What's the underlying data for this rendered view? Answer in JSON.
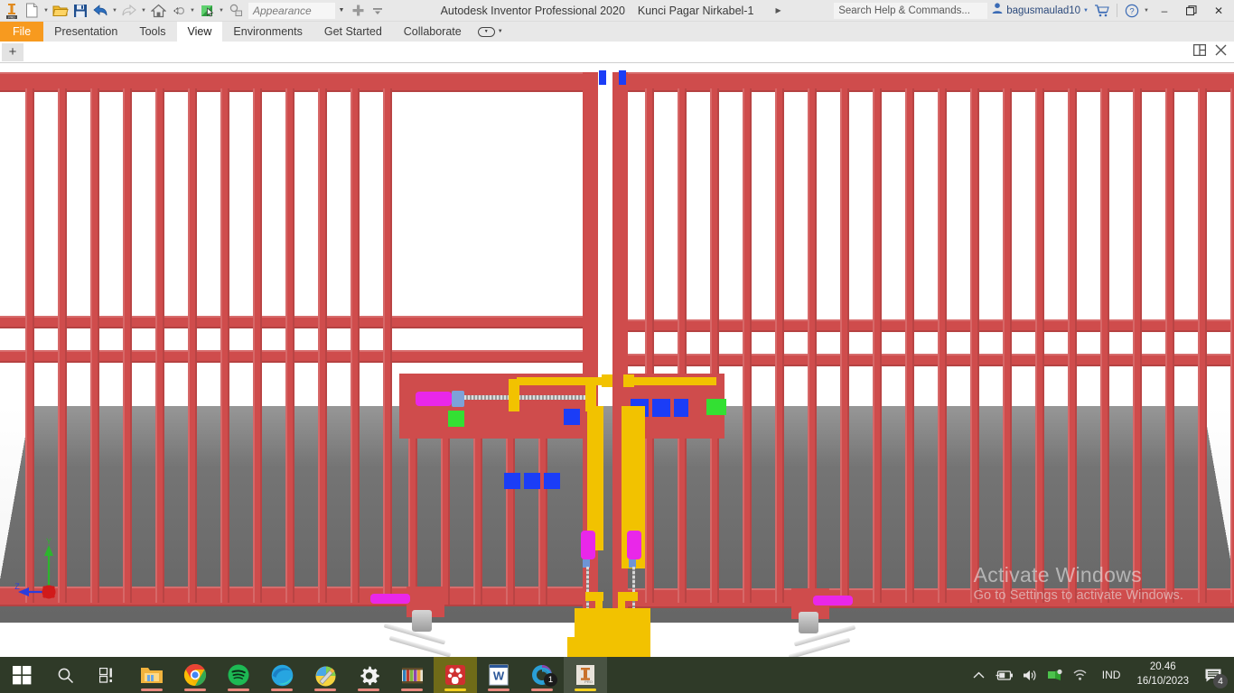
{
  "titlebar": {
    "app_logo": "inventor-pro-logo",
    "quick_access": [
      {
        "name": "new-document-icon",
        "has_caret": true
      },
      {
        "name": "open-folder-icon",
        "has_caret": false
      },
      {
        "name": "save-icon",
        "has_caret": false
      },
      {
        "name": "undo-icon",
        "has_caret": true
      },
      {
        "name": "redo-icon",
        "has_caret": true
      },
      {
        "name": "home-icon",
        "has_caret": false
      },
      {
        "name": "return-icon",
        "has_caret": true
      },
      {
        "name": "select-appearance-icon",
        "has_caret": true
      },
      {
        "name": "material-icon",
        "has_caret": false
      }
    ],
    "appearance_value": "Appearance",
    "add_icon": "plus-icon",
    "customize_icon": "dropdown-icon",
    "product_name": "Autodesk Inventor Professional 2020",
    "document_name": "Kunci Pagar Nirkabel-1",
    "title_overflow_icon": "right-arrow-icon",
    "search_placeholder": "Search Help & Commands...",
    "user_name": "bagusmaulad10",
    "user_icon": "user-icon",
    "cart_icon": "cart-icon",
    "help_icon": "help-icon",
    "window_controls": [
      {
        "name": "minimize-button",
        "glyph": "–"
      },
      {
        "name": "restore-button",
        "glyph": "❐"
      },
      {
        "name": "close-button",
        "glyph": "✕"
      }
    ]
  },
  "ribbon": {
    "tabs": [
      {
        "label": "File",
        "state": "file"
      },
      {
        "label": "Presentation",
        "state": "normal"
      },
      {
        "label": "Tools",
        "state": "normal"
      },
      {
        "label": "View",
        "state": "active"
      },
      {
        "label": "Environments",
        "state": "normal"
      },
      {
        "label": "Get Started",
        "state": "normal"
      },
      {
        "label": "Collaborate",
        "state": "normal"
      }
    ],
    "minimize_ribbon_icon": "ribbon-display-options-icon"
  },
  "doctabs": {
    "new_tab_label": "+",
    "split_view_icon": "split-window-icon",
    "close_document_icon": "close-icon"
  },
  "viewport": {
    "model_name": "Kunci Pagar Nirkabel",
    "axis": {
      "x_label": "X",
      "y_label": "Y",
      "z_label": "Z"
    },
    "colors": {
      "fence": "#cf4c4c",
      "ground": "#6b6b6b",
      "background": "#ffffff",
      "yellow_part": "#f2c200",
      "magenta_part": "#e927e9",
      "blue_part": "#1b3df7",
      "green_part": "#33e033"
    }
  },
  "watermark": {
    "line1": "Activate Windows",
    "line2": "Go to Settings to activate Windows."
  },
  "taskbar": {
    "items": [
      {
        "name": "start-button",
        "label": "Start",
        "running": false
      },
      {
        "name": "search-icon",
        "label": "Search",
        "running": false
      },
      {
        "name": "task-view-icon",
        "label": "Task View",
        "running": false
      },
      {
        "name": "file-explorer-icon",
        "label": "File Explorer",
        "running": true
      },
      {
        "name": "chrome-icon",
        "label": "Google Chrome",
        "running": true
      },
      {
        "name": "spotify-icon",
        "label": "Spotify",
        "running": true
      },
      {
        "name": "edge-icon",
        "label": "Microsoft Edge",
        "running": true
      },
      {
        "name": "paint-icon",
        "label": "Paint 3D",
        "running": true
      },
      {
        "name": "settings-gear-icon",
        "label": "Settings",
        "running": true
      },
      {
        "name": "winrar-icon",
        "label": "WinRAR",
        "running": true
      },
      {
        "name": "media-app-icon",
        "label": "Media App",
        "running": true
      },
      {
        "name": "word-icon",
        "label": "Microsoft Word",
        "running": true
      },
      {
        "name": "cortana-app-icon",
        "label": "App",
        "running": true,
        "badge": "1"
      },
      {
        "name": "inventor-icon",
        "label": "Autodesk Inventor",
        "running": true
      }
    ],
    "tray": {
      "overflow_icon": "chevron-up-icon",
      "battery_icon": "battery-icon",
      "volume_icon": "volume-icon",
      "network_action_icon": "network-icon",
      "wifi_icon": "wifi-icon",
      "language": "IND",
      "time": "20.46",
      "date": "16/10/2023",
      "notification_icon": "notification-icon",
      "notification_count": "4"
    }
  }
}
